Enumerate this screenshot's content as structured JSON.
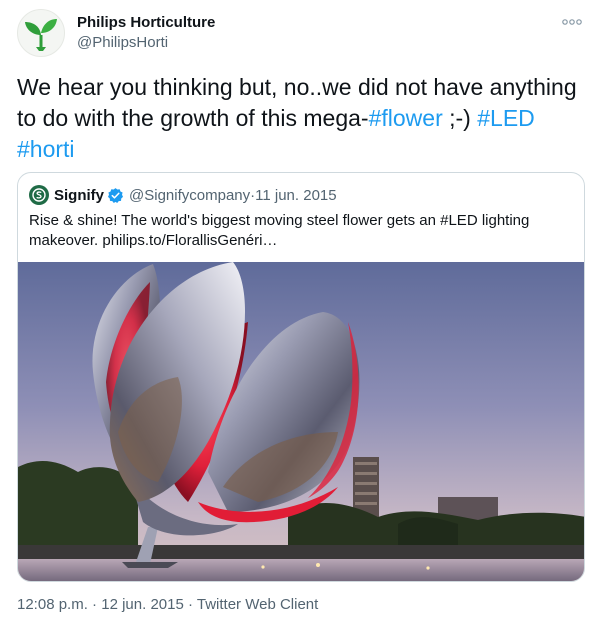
{
  "author": {
    "name": "Philips Horticulture",
    "handle": "@PhilipsHorti",
    "avatar_icon": "leaf-sprout-icon"
  },
  "tweet": {
    "text_plain": "We hear you thinking but, no..we did not have anything to do with the growth of this mega-",
    "hashtag_flower": "#flower",
    "text_middle": " ;-) ",
    "hashtag_led": "#LED",
    "hashtag_horti": "#horti"
  },
  "quoted_tweet": {
    "name": "Signify",
    "handle": "@Signifycompany",
    "separator": " · ",
    "date": "11 jun. 2015",
    "text": "Rise & shine! The world's biggest moving steel flower gets an #LED lighting makeover. philips.to/FlorallisGenéri…",
    "image_icon": "floralis-generica-photo"
  },
  "footer": {
    "time": "12:08 p.m.",
    "date": "12 jun. 2015",
    "client": "Twitter Web Client",
    "separator": " · "
  },
  "colors": {
    "link": "#1d9bf0",
    "secondary_text": "#536471",
    "border": "#cfd9de",
    "brand_green": "#2f9e3a"
  }
}
